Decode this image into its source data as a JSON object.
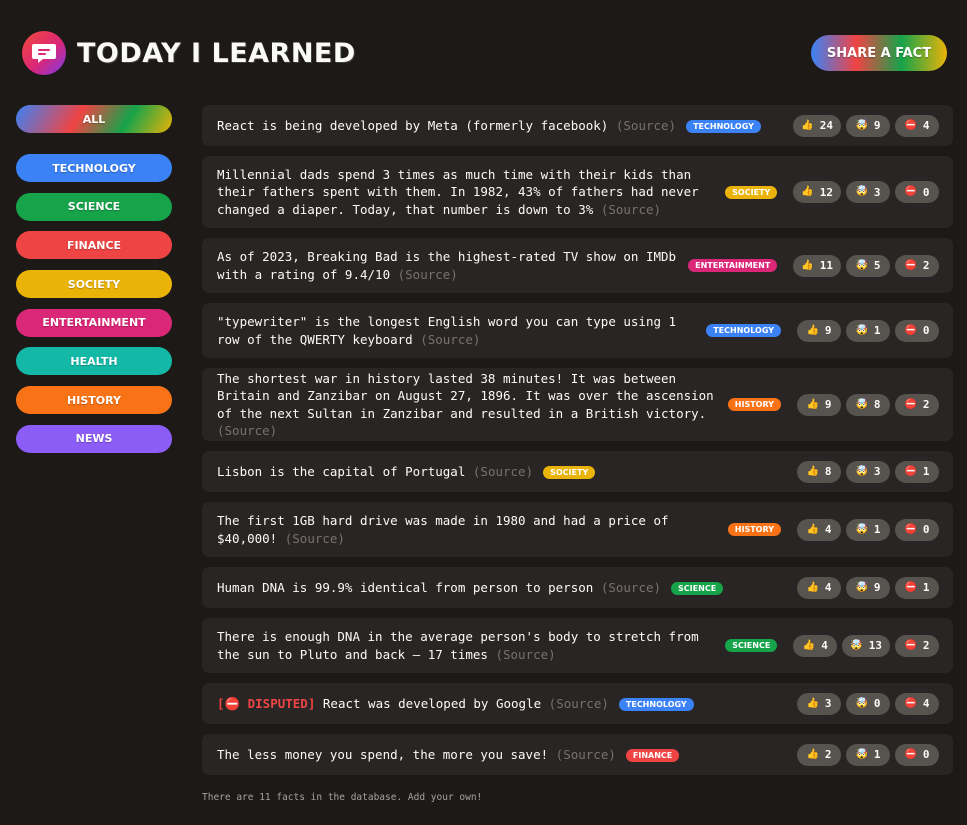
{
  "header": {
    "title": "Today I Learned",
    "share_label": "Share a fact"
  },
  "categories": {
    "all_label": "All",
    "items": [
      {
        "label": "Technology",
        "color": "#3b82f6"
      },
      {
        "label": "Science",
        "color": "#16a34a"
      },
      {
        "label": "Finance",
        "color": "#ef4444"
      },
      {
        "label": "Society",
        "color": "#eab308"
      },
      {
        "label": "Entertainment",
        "color": "#db2777"
      },
      {
        "label": "Health",
        "color": "#14b8a6"
      },
      {
        "label": "History",
        "color": "#f97316"
      },
      {
        "label": "News",
        "color": "#8b5cf6"
      }
    ]
  },
  "source_label": "(Source)",
  "disputed_label": "[⛔ DISPUTED]",
  "icons": {
    "like": "thumbs-up-icon",
    "mindblown": "mind-blown-icon",
    "false": "no-entry-icon"
  },
  "facts": [
    {
      "text": "React is being developed by Meta (formerly facebook)",
      "category": "Technology",
      "color": "#3b82f6",
      "likes": "24",
      "mindblown": "9",
      "false": "4"
    },
    {
      "text": "Millennial dads spend 3 times as much time with their kids than their fathers spent with them. In 1982, 43% of fathers had never changed a diaper. Today, that number is down to 3%",
      "category": "Society",
      "color": "#eab308",
      "likes": "12",
      "mindblown": "3",
      "false": "0"
    },
    {
      "text": "As of 2023, Breaking Bad is the highest-rated TV show on IMDb with a rating of 9.4/10",
      "category": "Entertainment",
      "color": "#db2777",
      "likes": "11",
      "mindblown": "5",
      "false": "2"
    },
    {
      "text": "\"typewriter\" is the longest English word you can type using 1 row of the QWERTY keyboard",
      "category": "Technology",
      "color": "#3b82f6",
      "likes": "9",
      "mindblown": "1",
      "false": "0"
    },
    {
      "text": "The shortest war in history lasted 38 minutes! It was between Britain and Zanzibar on August 27, 1896. It was over the ascension of the next Sultan in Zanzibar and resulted in a British victory.",
      "category": "History",
      "color": "#f97316",
      "likes": "9",
      "mindblown": "8",
      "false": "2"
    },
    {
      "text": "Lisbon is the capital of Portugal",
      "category": "Society",
      "color": "#eab308",
      "likes": "8",
      "mindblown": "3",
      "false": "1"
    },
    {
      "text": "The first 1GB hard drive was made in 1980 and had a price of $40,000!",
      "category": "History",
      "color": "#f97316",
      "likes": "4",
      "mindblown": "1",
      "false": "0"
    },
    {
      "text": "Human DNA is 99.9% identical from person to person",
      "category": "Science",
      "color": "#16a34a",
      "likes": "4",
      "mindblown": "9",
      "false": "1"
    },
    {
      "text": "There is enough DNA in the average person's body to stretch from the sun to Pluto and back — 17 times",
      "category": "Science",
      "color": "#16a34a",
      "likes": "4",
      "mindblown": "13",
      "false": "2"
    },
    {
      "text": "React was developed by Google",
      "category": "Technology",
      "color": "#3b82f6",
      "likes": "3",
      "mindblown": "0",
      "false": "4"
    },
    {
      "text": "The less money you spend, the more you save!",
      "category": "Finance",
      "color": "#ef4444",
      "likes": "2",
      "mindblown": "1",
      "false": "0"
    }
  ],
  "footer_note": "There are 11 facts in the database. Add your own!"
}
